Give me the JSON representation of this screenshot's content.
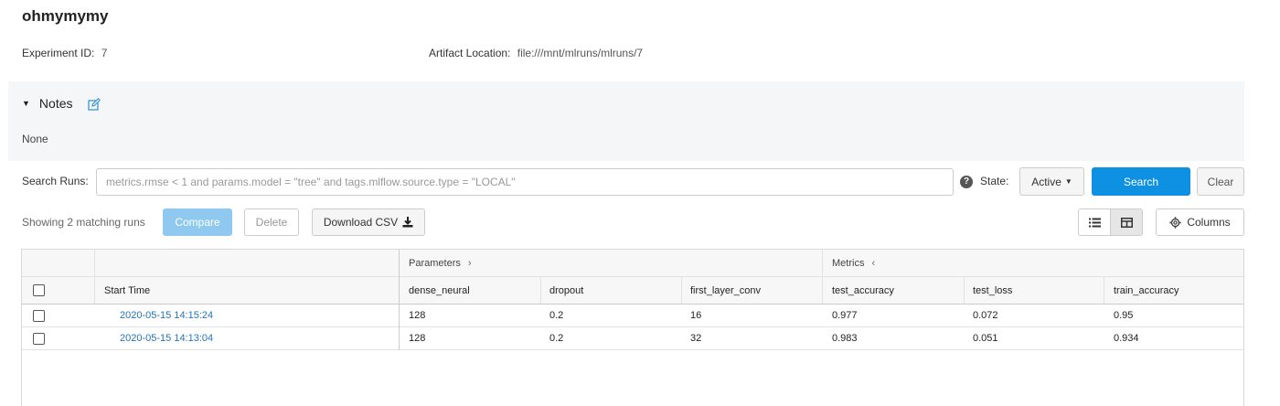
{
  "experiment": {
    "name": "ohmymymy",
    "id_label": "Experiment ID",
    "id_value": "7",
    "artifact_label": "Artifact Location",
    "artifact_value": "file:///mnt/mlruns/mlruns/7"
  },
  "notes": {
    "label": "Notes",
    "content": "None",
    "caret_icon": "caret-down-icon",
    "edit_icon": "edit-icon"
  },
  "search": {
    "label": "Search Runs:",
    "placeholder": "metrics.rmse < 1 and params.model = \"tree\" and tags.mlflow.source.type = \"LOCAL\"",
    "value": "",
    "state_label": "State:",
    "state_value": "Active",
    "search_button": "Search",
    "clear_button": "Clear"
  },
  "toolbar": {
    "showing": "Showing 2 matching runs",
    "compare": "Compare",
    "delete": "Delete",
    "download_csv": "Download CSV",
    "columns": "Columns"
  },
  "table": {
    "group_headers": {
      "parameters": "Parameters",
      "metrics": "Metrics"
    },
    "columns": [
      "Start Time",
      "dense_neural",
      "dropout",
      "first_layer_conv",
      "test_accuracy",
      "test_loss",
      "train_accuracy"
    ],
    "rows": [
      [
        "2020-05-15 14:15:24",
        "128",
        "0.2",
        "16",
        "0.977",
        "0.072",
        "0.95"
      ],
      [
        "2020-05-15 14:13:04",
        "128",
        "0.2",
        "32",
        "0.983",
        "0.051",
        "0.934"
      ]
    ]
  },
  "colors": {
    "primary": "#0e91e3",
    "primary_disabled": "#8fc9f0",
    "link": "#2374bb",
    "panel_bg": "#f5f6f7"
  }
}
